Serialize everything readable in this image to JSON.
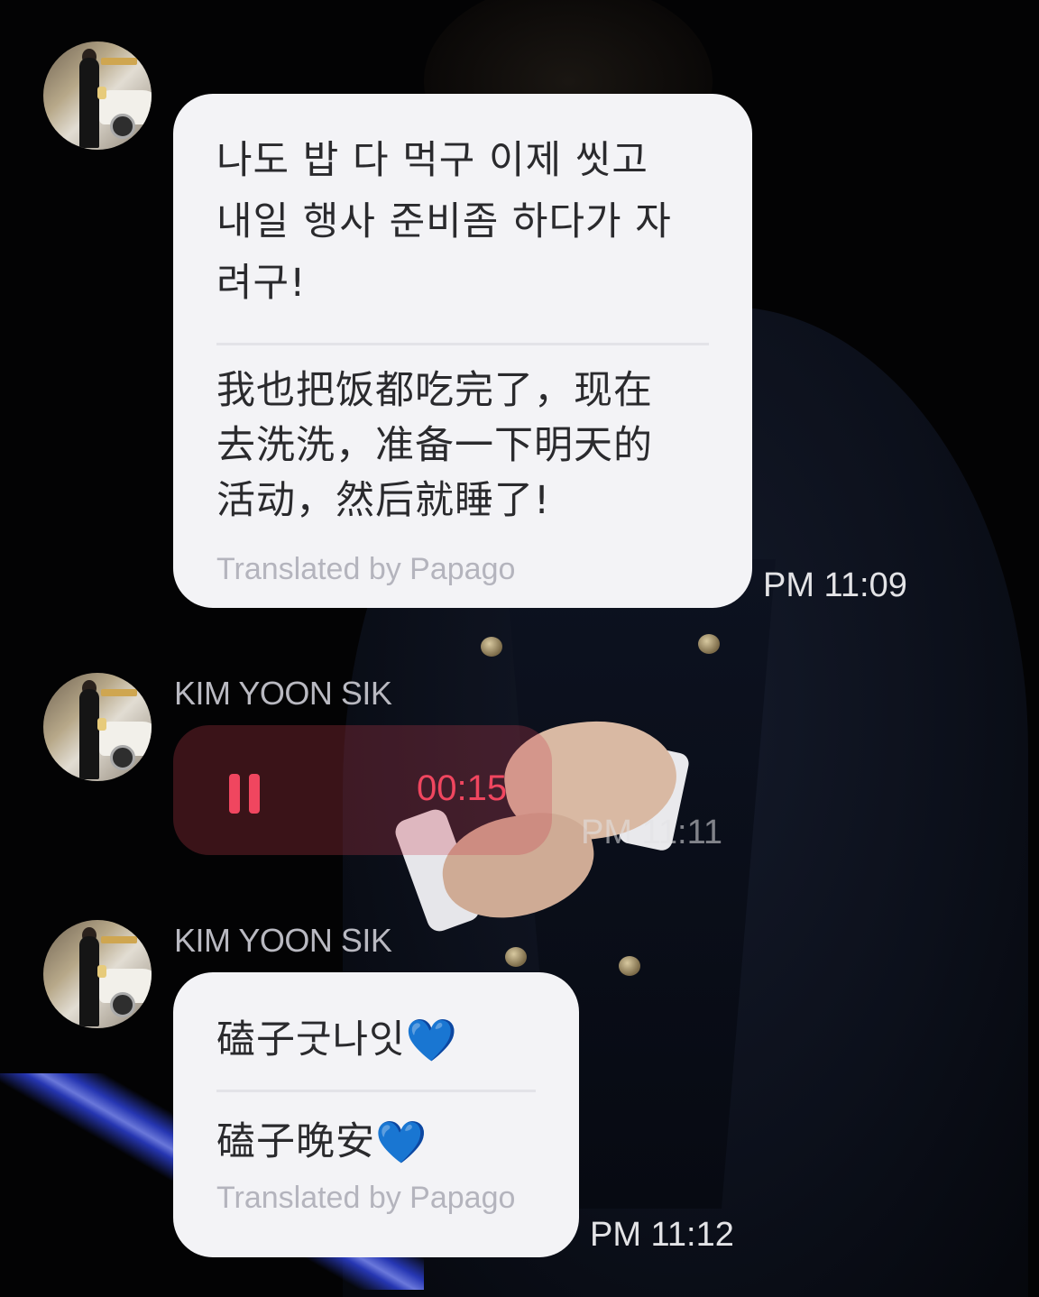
{
  "messages": [
    {
      "original_lines": [
        "나도 밥 다 먹구 이제 씻고",
        "내일 행사 준비좀 하다가 자",
        "려구!"
      ],
      "translation_lines": [
        "我也把饭都吃完了，现在",
        "去洗洗，准备一下明天的",
        "活动，然后就睡了!"
      ],
      "translated_by": "Translated by Papago",
      "time": "PM 11:09"
    },
    {
      "sender": "KIM YOON SIK",
      "voice_duration": "00:15",
      "time": "PM 11:11",
      "pause_icon": "pause-icon"
    },
    {
      "sender": "KIM YOON SIK",
      "original": "磕子굿나잇",
      "translation": "磕子晚安",
      "heart": "💙",
      "translated_by": "Translated by Papago",
      "time": "PM 11:12"
    }
  ],
  "colors": {
    "bubble": "#f3f3f6",
    "accent_red": "#f0465f",
    "heart": "#4fd3f0"
  }
}
